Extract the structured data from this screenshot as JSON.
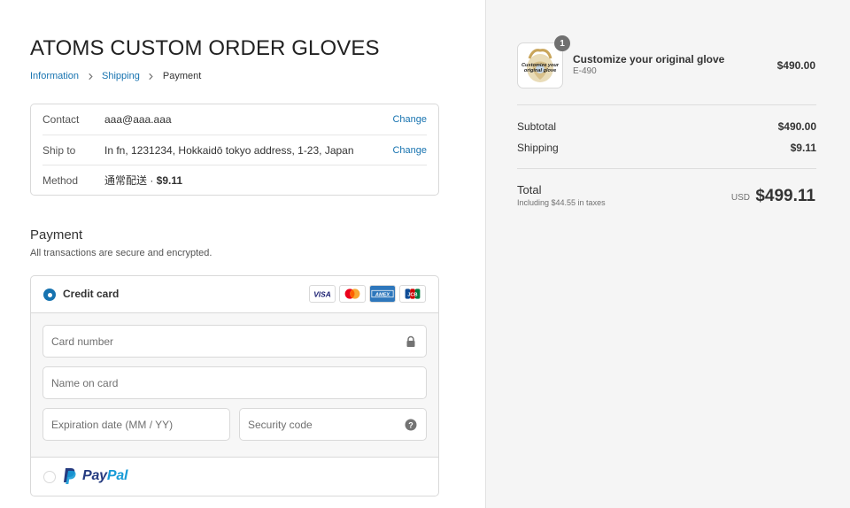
{
  "store": {
    "title": "ATOMS CUSTOM ORDER GLOVES"
  },
  "breadcrumb": {
    "items": [
      {
        "label": "Information",
        "state": "link"
      },
      {
        "label": "Shipping",
        "state": "link"
      },
      {
        "label": "Payment",
        "state": "current"
      }
    ],
    "separator_icon": "chevron-right-icon"
  },
  "review": {
    "contact": {
      "label": "Contact",
      "value": "aaa@aaa.aaa",
      "action": "Change"
    },
    "ship_to": {
      "label": "Ship to",
      "value": "In fn, 1231234, Hokkaidō tokyo address, 1-23, Japan",
      "action": "Change"
    },
    "method": {
      "label": "Method",
      "value": "通常配送 · ",
      "price": "$9.11"
    }
  },
  "payment": {
    "title": "Payment",
    "subtitle": "All transactions are secure and encrypted.",
    "credit_card": {
      "label": "Credit card",
      "selected": true,
      "card_brands": [
        "visa",
        "mastercard",
        "amex",
        "jcb"
      ],
      "fields": {
        "card_number": {
          "placeholder": "Card number",
          "value": "",
          "icon": "lock-icon"
        },
        "name_on_card": {
          "placeholder": "Name on card",
          "value": ""
        },
        "expiration": {
          "placeholder": "Expiration date (MM / YY)",
          "value": ""
        },
        "security_code": {
          "placeholder": "Security code",
          "value": "",
          "icon": "help-icon"
        }
      }
    },
    "paypal": {
      "label_part1": "Pay",
      "label_part2": "Pal",
      "selected": false
    }
  },
  "summary": {
    "item": {
      "name": "Customize your original glove",
      "variant": "E-490",
      "quantity": "1",
      "price": "$490.00",
      "thumbnail_text": "Customize your original glove"
    },
    "subtotal": {
      "label": "Subtotal",
      "value": "$490.00"
    },
    "shipping": {
      "label": "Shipping",
      "value": "$9.11"
    },
    "total": {
      "label": "Total",
      "taxes_note": "Including $44.55 in taxes",
      "currency": "USD",
      "amount": "$499.11"
    }
  },
  "colors": {
    "accent": "#1773b0",
    "sidebar_bg": "#f5f5f5",
    "border": "#d9d9d9",
    "paypal_dark": "#253b80",
    "paypal_light": "#179bd7"
  }
}
